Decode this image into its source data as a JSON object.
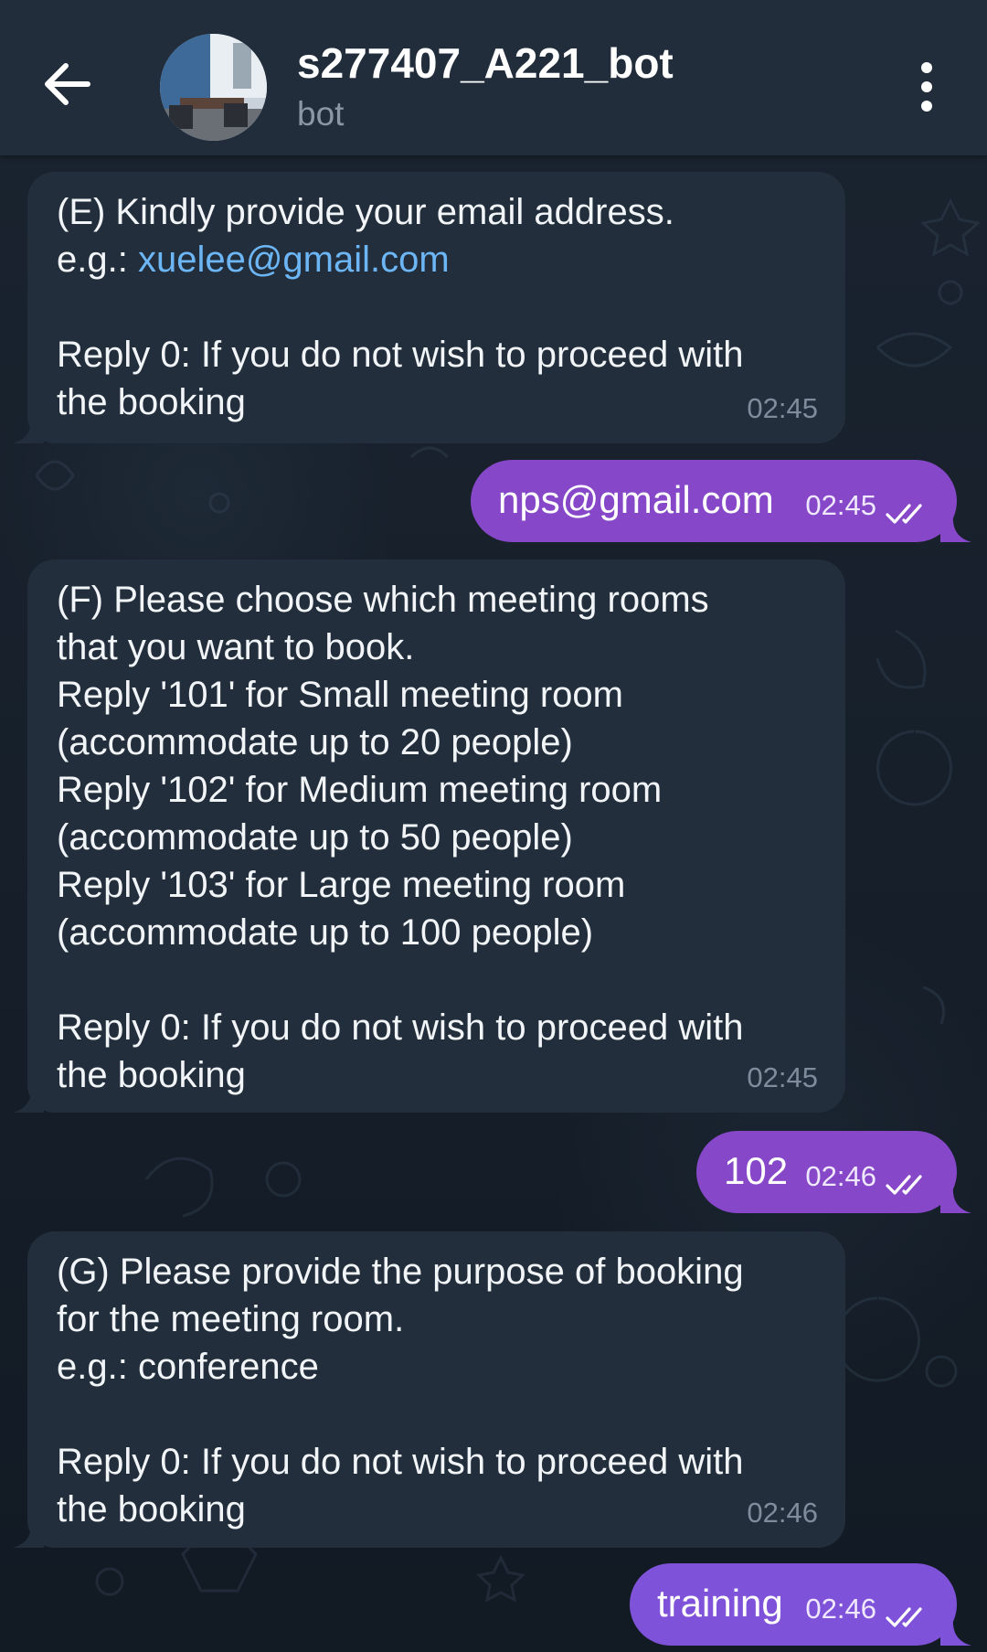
{
  "header": {
    "title": "s277407_A221_bot",
    "subtitle": "bot",
    "back_icon": "arrow-left-icon",
    "menu_icon": "more-vertical-icon"
  },
  "colors": {
    "header_bg": "#212d3b",
    "incoming_bubble": "#222e3b",
    "outgoing_bubble": "#8648c8",
    "link": "#6db6f6"
  },
  "messages": [
    {
      "direction": "in",
      "lines": [
        "(E) Kindly provide your email address.",
        "e.g.: ",
        "",
        "Reply 0: If you do not wish to proceed with",
        "the booking"
      ],
      "link_text": "xuelee@gmail.com",
      "time": "02:45"
    },
    {
      "direction": "out",
      "text": "nps@gmail.com",
      "time": "02:45",
      "status_icon": "double-check-icon"
    },
    {
      "direction": "in",
      "lines": [
        "(F) Please choose which meeting rooms",
        "that you want to book.",
        "Reply '101' for Small meeting room",
        "(accommodate up to 20 people)",
        "Reply '102' for Medium meeting room",
        "(accommodate up to 50 people)",
        "Reply '103' for Large meeting room",
        "(accommodate up to 100 people)",
        "",
        "Reply 0: If you do not wish to proceed with",
        "the booking"
      ],
      "time": "02:45"
    },
    {
      "direction": "out",
      "text": "102",
      "time": "02:46",
      "status_icon": "double-check-icon"
    },
    {
      "direction": "in",
      "lines": [
        "(G) Please provide the purpose of booking",
        "for the meeting room.",
        "e.g.: conference",
        "",
        "Reply 0: If you do not wish to proceed with",
        "the booking"
      ],
      "time": "02:46"
    },
    {
      "direction": "out",
      "text": "training",
      "time": "02:46",
      "status_icon": "double-check-icon"
    }
  ]
}
